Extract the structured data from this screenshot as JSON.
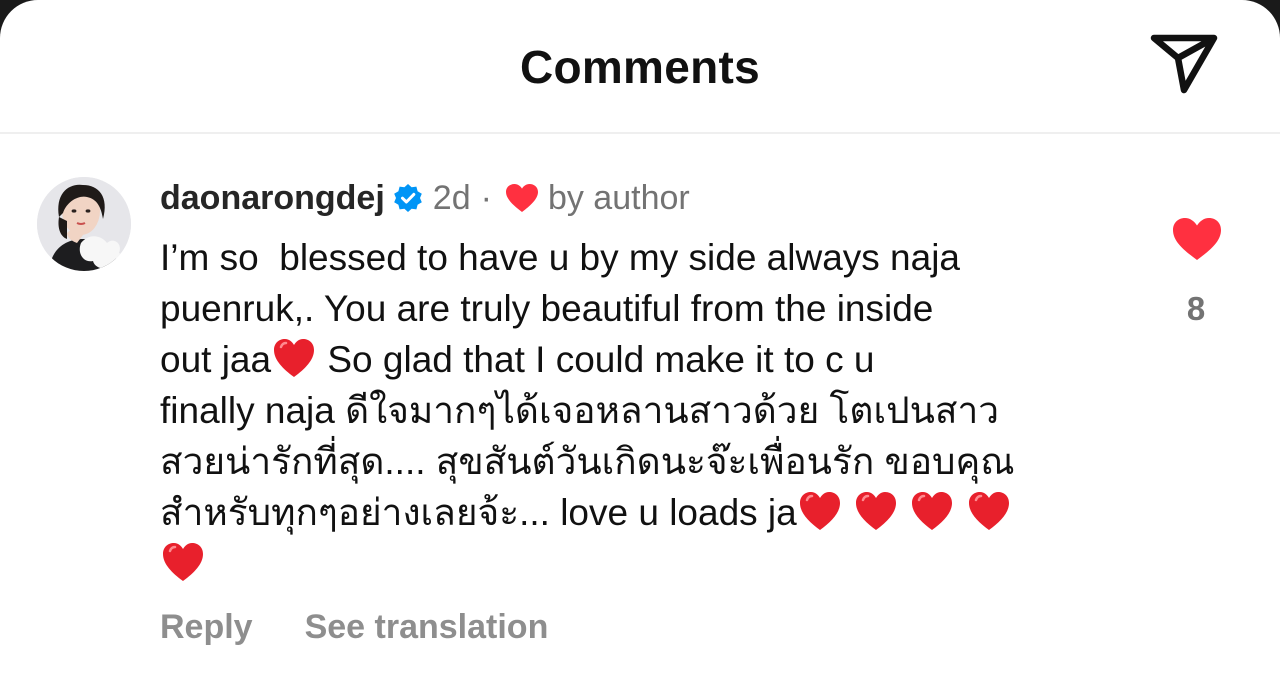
{
  "header": {
    "title": "Comments",
    "share_icon": "paper-plane-icon"
  },
  "comment": {
    "username": "daonarongdej",
    "verified": true,
    "time": "2d",
    "separator": "·",
    "author_badge": "by author",
    "text_segments": [
      "I’m so  blessed to have u by my side always naja\npuenruk,. You are truly beautiful from the inside\nout jaa",
      " So glad that I could make it to c u\nfinally naja ดีใจมากๆได้เจอหลานสาวด้วย โตเปนสาว\nสวยน่ารักที่สุด.... สุขสันต์วันเกิดนะจ๊ะเพื่อนรัก ขอบคุณ\nสำหรับทุกๆอย่างเลยจ้ะ... love u loads ja"
    ],
    "emoji": "red-heart-emoji",
    "like_count": "8",
    "actions": {
      "reply": "Reply",
      "see_translation": "See translation"
    }
  },
  "colors": {
    "heart": "#ff3040",
    "emoji_heart": "#e8202c",
    "verified": "#0095f6",
    "secondary_text": "#737373",
    "action_text": "#8e8e8e"
  }
}
